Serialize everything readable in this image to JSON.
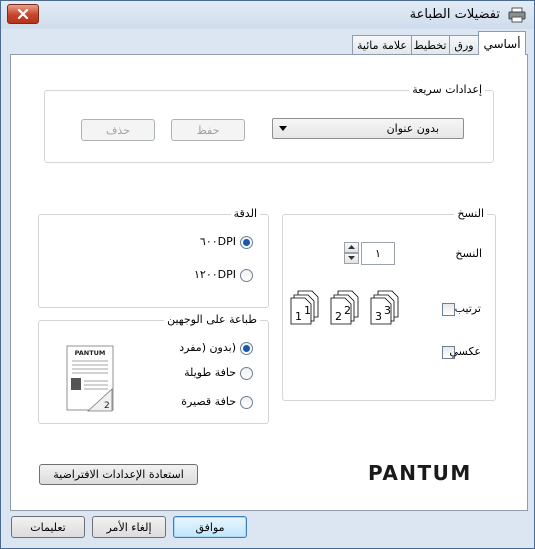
{
  "window": {
    "title": "تفضيلات الطباعة",
    "close_icon": "close-icon",
    "printer_icon": "printer-icon"
  },
  "tabs": [
    {
      "label": "أساسي",
      "active": true
    },
    {
      "label": "ورق",
      "active": false
    },
    {
      "label": "تخطيط",
      "active": false
    },
    {
      "label": "علامة مائية",
      "active": false
    }
  ],
  "quick_settings": {
    "legend": "إعدادات سريعة",
    "preset_value": "بدون عنوان",
    "save_label": "حفظ",
    "delete_label": "حذف"
  },
  "copies": {
    "legend": "النسخ",
    "copies_label": "النسخ",
    "copies_value": "١",
    "collate_label": "ترتيب",
    "collate_checked": false,
    "reverse_label": "عكسي",
    "reverse_checked": false
  },
  "resolution": {
    "legend": "الدقة",
    "options": [
      {
        "label": "٦٠٠DPI",
        "selected": true
      },
      {
        "label": "١٢٠٠DPI",
        "selected": false
      }
    ]
  },
  "duplex": {
    "legend": "طباعة على الوجهين",
    "options": [
      {
        "label": "(بدون (مفرد",
        "selected": true
      },
      {
        "label": "حافة طويلة",
        "selected": false
      },
      {
        "label": "حافة قصيرة",
        "selected": false
      }
    ],
    "preview_brand": "PANTUM"
  },
  "restore_defaults_label": "استعادة الإعدادات الافتراضية",
  "brand_logo": "PANTUM",
  "footer": {
    "ok_label": "موافق",
    "cancel_label": "إلغاء الأمر",
    "help_label": "تعليمات"
  },
  "colors": {
    "accent": "#1b58a8",
    "close_button": "#c7442b",
    "brand": "#1a1a1a"
  }
}
